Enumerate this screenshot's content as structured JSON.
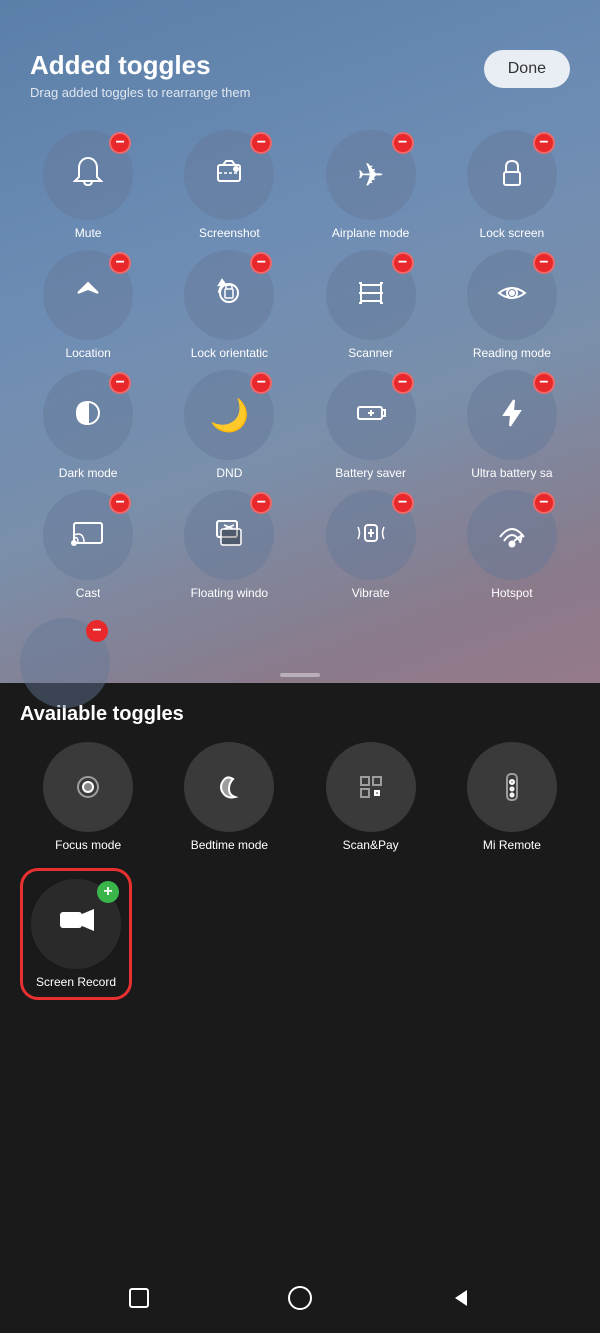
{
  "header": {
    "title": "Added toggles",
    "subtitle": "Drag added toggles to rearrange them",
    "done_label": "Done"
  },
  "added_section": {
    "label": "Added toggles"
  },
  "added_toggles": [
    {
      "id": "mute",
      "label": "Mute",
      "icon": "bell"
    },
    {
      "id": "screenshot",
      "label": "Screenshot",
      "icon": "screenshot"
    },
    {
      "id": "airplane",
      "label": "Airplane mode",
      "icon": "airplane"
    },
    {
      "id": "lockscreen",
      "label": "Lock screen",
      "icon": "lock"
    },
    {
      "id": "location",
      "label": "Location",
      "icon": "location"
    },
    {
      "id": "lock-orientation",
      "label": "Lock orientatic",
      "icon": "rotate-lock"
    },
    {
      "id": "scanner",
      "label": "Scanner",
      "icon": "scanner"
    },
    {
      "id": "reading",
      "label": "Reading mode",
      "icon": "eye"
    },
    {
      "id": "darkmode",
      "label": "Dark mode",
      "icon": "darkmode"
    },
    {
      "id": "dnd",
      "label": "DND",
      "icon": "moon"
    },
    {
      "id": "battery-saver",
      "label": "Battery saver",
      "icon": "battery"
    },
    {
      "id": "ultra-battery",
      "label": "Ultra battery sa",
      "icon": "bolt"
    },
    {
      "id": "cast",
      "label": "Cast",
      "icon": "cast"
    },
    {
      "id": "floating",
      "label": "Floating windo",
      "icon": "floating"
    },
    {
      "id": "vibrate",
      "label": "Vibrate",
      "icon": "vibrate"
    },
    {
      "id": "hotspot",
      "label": "Hotspot",
      "icon": "hotspot"
    }
  ],
  "available_section": {
    "title": "Available toggles"
  },
  "available_toggles": [
    {
      "id": "focus",
      "label": "Focus mode",
      "icon": "focus"
    },
    {
      "id": "bedtime",
      "label": "Bedtime mode",
      "icon": "bedtime"
    },
    {
      "id": "scanpay",
      "label": "Scan&Pay",
      "icon": "scanpay"
    },
    {
      "id": "miremote",
      "label": "Mi Remote",
      "icon": "miremote"
    }
  ],
  "screen_record": {
    "label": "Screen Record",
    "icon": "video-camera"
  },
  "nav": {
    "square_label": "square",
    "circle_label": "circle",
    "back_label": "back"
  }
}
